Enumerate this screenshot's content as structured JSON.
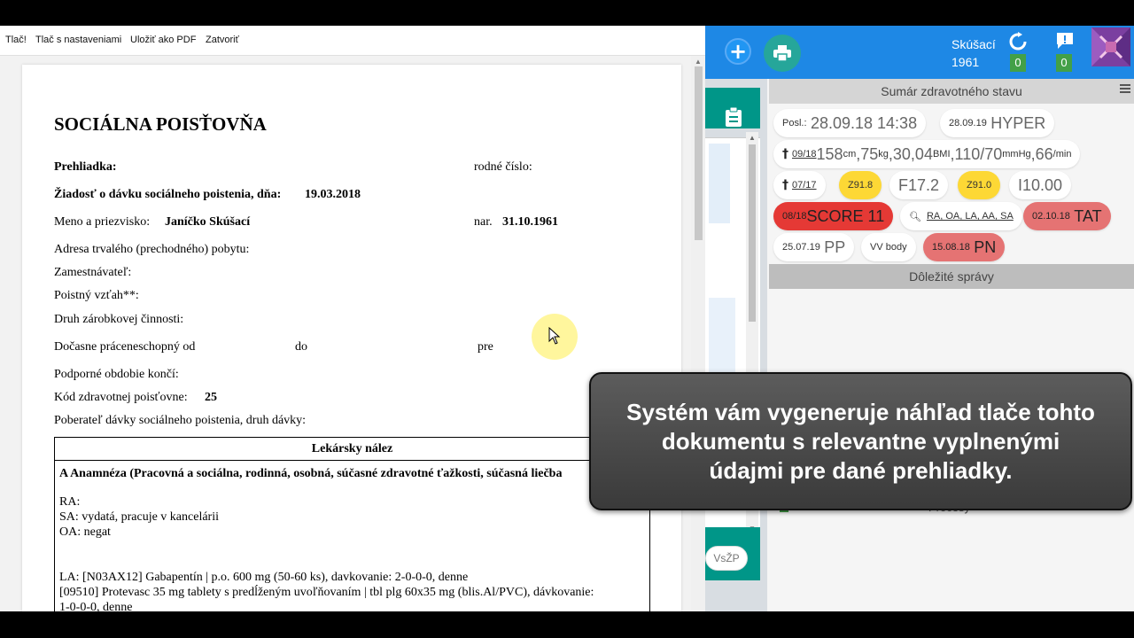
{
  "toolbar": {
    "print": "Tlač!",
    "print_settings": "Tlač s nastaveniami",
    "save_pdf": "Uložiť ako PDF",
    "close": "Zatvoriť"
  },
  "document": {
    "title": "SOCIÁLNA POISŤOVŇA",
    "prehliadka_label": "Prehliadka:",
    "rodne_cislo_label": "rodné číslo:",
    "ziadost_label": "Žiadosť o dávku sociálneho poistenia, dňa:",
    "ziadost_date": "19.03.2018",
    "meno_label": "Meno a priezvisko:",
    "meno_value": "Janíčko Skúšací",
    "nar_label": "nar.",
    "nar_value": "31.10.1961",
    "adresa_label": "Adresa trvalého (prechodného) pobytu:",
    "zamestnavatel_label": "Zamestnávateľ:",
    "poistny_label": "Poistný vzťah**:",
    "druh_label": "Druh zárobkovej činnosti:",
    "pn_od_label": "Dočasne práceneschopný od",
    "do_label": "do",
    "pre_label": "pre",
    "podporne_label": "Podporné obdobie končí:",
    "kod_label": "Kód zdravotnej poisťovne:",
    "kod_value": "25",
    "poberatel_label": "Poberateľ dávky sociálneho poistenia, druh dávky:",
    "nalez_title": "Lekársky nález",
    "anamneza_heading": "A Anamnéza (Pracovná a sociálna, rodinná, osobná, súčasné zdravotné ťažkosti, súčasná liečba",
    "ra": "RA:",
    "sa": "SA: vydatá, pracuje v kancelárii",
    "oa": "OA: negat",
    "la1": "LA: [N03AX12] Gabapentín | p.o. 600 mg (50-60 ks), davkovanie: 2-0-0-0, denne",
    "la2": "[09510] Protevasc 35 mg tablety s predĺženým uvoľňovaním | tbl plg 60x35 mg (blis.Al/PVC), dávkovanie:",
    "la3": "1-0-0-0, denne"
  },
  "app": {
    "patient_name": "Skúšací",
    "patient_year": "1961",
    "sync_count": "0",
    "message_count": "0",
    "summary_title": "Sumár zdravotného stavu",
    "important_title": "Dôležité správy",
    "processes_label": "Procesy",
    "vszp_label": "VsŽP",
    "chips": {
      "posl_label": "Posl.:",
      "posl_value": "28.09.18 14:38",
      "hyper_date": "28.09.19",
      "hyper_label": "HYPER",
      "vitals_date": "09/18",
      "height": "158",
      "height_unit": "cm",
      "weight": ",75",
      "weight_unit": "kg",
      "bmi": ",30,04",
      "bmi_unit": "BMI",
      "bp": ",110/70",
      "bp_unit": "mmHg",
      "pulse": ",66",
      "pulse_unit": "/min",
      "dx_date": "07/17",
      "z918": "Z91.8",
      "f172": "F17.2",
      "z910": "Z91.0",
      "i1000": "I10.00",
      "score_date": "08/18",
      "score_label": "SCORE 11",
      "anamnesis_short": "RA, OA, LA, AA, SA",
      "tat_date": "02.10.18",
      "tat_label": "TAT",
      "pp_date": "25.07.19",
      "pp_label": "PP",
      "vv_label": "VV body",
      "pn_date": "15.08.18",
      "pn_label": "PN"
    },
    "colors": {
      "header_blue": "#1e88e5",
      "teal": "#009688",
      "yellow": "#fdd835",
      "red": "#e53935",
      "pink": "#e57373",
      "green": "#43a047"
    }
  },
  "tooltip": {
    "text": "Systém vám vygeneruje náhľad tlače tohto dokumentu s relevantne vyplnenými údajmi pre dané prehliadky."
  }
}
